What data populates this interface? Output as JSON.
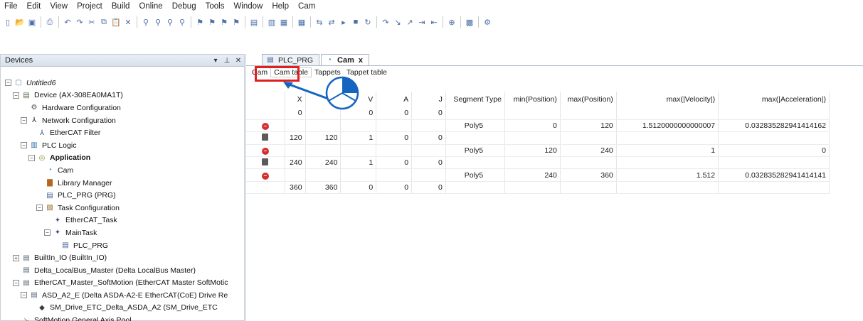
{
  "menu": [
    "File",
    "Edit",
    "View",
    "Project",
    "Build",
    "Online",
    "Debug",
    "Tools",
    "Window",
    "Help",
    "Cam"
  ],
  "toolbar": {
    "icons": [
      "new-icon",
      "open-icon",
      "save-icon",
      "sep",
      "print-icon",
      "sep",
      "undo-icon",
      "redo-icon",
      "cut-icon",
      "copy-icon",
      "paste-icon",
      "delete-icon",
      "sep",
      "find-icon",
      "find-next-icon",
      "find-in-project-icon",
      "replace-icon",
      "sep",
      "bookmark-icon",
      "bookmark-next-icon",
      "bookmark-prev-icon",
      "bookmark-clear-icon",
      "sep",
      "device-icon",
      "sep",
      "compile-icon",
      "generate-icon",
      "sep",
      "grid-icon",
      "sep",
      "login-icon",
      "logout-icon",
      "run-icon",
      "stop-icon",
      "reset-icon",
      "sep",
      "step-over-icon",
      "step-into-icon",
      "step-out-icon",
      "run-to-cursor-icon",
      "set-next-icon",
      "sep",
      "breakpoint-icon",
      "sep",
      "monitor-icon",
      "sep",
      "settings-icon"
    ]
  },
  "devices": {
    "title": "Devices",
    "controls": {
      "pin": "▾",
      "dock": "⊥",
      "close": "✕"
    },
    "tree": [
      {
        "level": 0,
        "exp": "−",
        "icon": "project-icon",
        "label": "Untitled6",
        "style": "italic"
      },
      {
        "level": 1,
        "exp": "−",
        "icon": "device-icon",
        "label": "Device (AX-308EA0MA1T)"
      },
      {
        "level": 2,
        "exp": "",
        "icon": "hardware-config-icon",
        "label": "Hardware Configuration"
      },
      {
        "level": 2,
        "exp": "−",
        "icon": "network-config-icon",
        "label": "Network Configuration"
      },
      {
        "level": 3,
        "exp": "",
        "icon": "ethercat-filter-icon",
        "label": "EtherCAT Filter"
      },
      {
        "level": 2,
        "exp": "−",
        "icon": "plc-logic-icon",
        "label": "PLC Logic"
      },
      {
        "level": 3,
        "exp": "−",
        "icon": "application-icon",
        "label": "Application",
        "style": "bold"
      },
      {
        "level": 4,
        "exp": "",
        "icon": "cam-icon",
        "label": "Cam"
      },
      {
        "level": 4,
        "exp": "",
        "icon": "library-icon",
        "label": "Library Manager"
      },
      {
        "level": 4,
        "exp": "",
        "icon": "pou-icon",
        "label": "PLC_PRG (PRG)"
      },
      {
        "level": 4,
        "exp": "−",
        "icon": "task-config-icon",
        "label": "Task Configuration"
      },
      {
        "level": 5,
        "exp": "",
        "icon": "task-icon",
        "label": "EtherCAT_Task"
      },
      {
        "level": 5,
        "exp": "−",
        "icon": "task-icon",
        "label": "MainTask"
      },
      {
        "level": 6,
        "exp": "",
        "icon": "pou-call-icon",
        "label": "PLC_PRG"
      },
      {
        "level": 1,
        "exp": "+",
        "icon": "io-icon",
        "label": "BuiltIn_IO (BuiltIn_IO)"
      },
      {
        "level": 1,
        "exp": "",
        "icon": "io-icon",
        "label": "Delta_LocalBus_Master (Delta LocalBus Master)"
      },
      {
        "level": 1,
        "exp": "−",
        "icon": "io-icon",
        "label": "EtherCAT_Master_SoftMotion (EtherCAT Master SoftMotic"
      },
      {
        "level": 2,
        "exp": "−",
        "icon": "io-icon",
        "label": "ASD_A2_E (Delta ASDA-A2-E EtherCAT(CoE) Drive Re"
      },
      {
        "level": 3,
        "exp": "",
        "icon": "axis-icon",
        "label": "SM_Drive_ETC_Delta_ASDA_A2 (SM_Drive_ETC"
      },
      {
        "level": 1,
        "exp": "",
        "icon": "axis-pool-icon",
        "label": "SoftMotion General Axis Pool"
      }
    ]
  },
  "editor": {
    "tabs": [
      {
        "label": "PLC_PRG",
        "icon": "pou-icon",
        "active": false
      },
      {
        "label": "Cam",
        "icon": "cam-icon",
        "active": true,
        "close": "x"
      }
    ],
    "subtabs": [
      "Cam",
      "Cam table",
      "Tappets",
      "Tappet table"
    ],
    "selected_subtab": "Cam table",
    "table": {
      "headers": [
        "",
        "X",
        "Y",
        "V",
        "A",
        "J",
        "Segment Type",
        "min(Position)",
        "max(Position)",
        "max(|Velocity|)",
        "max(|Acceleration|)"
      ],
      "rows": [
        {
          "kind": "point",
          "icon": "",
          "cells": [
            "0",
            "",
            "0",
            "0",
            "0",
            "",
            "",
            "",
            "",
            ""
          ]
        },
        {
          "kind": "segment",
          "icon": "delete-segment-icon",
          "cells": [
            "",
            "",
            "",
            "",
            "",
            "Poly5",
            "0",
            "120",
            "1.5120000000000007",
            "0.032835282941414162"
          ]
        },
        {
          "kind": "point",
          "icon": "delete-point-icon",
          "cells": [
            "120",
            "120",
            "1",
            "0",
            "0",
            "",
            "",
            "",
            "",
            ""
          ]
        },
        {
          "kind": "segment",
          "icon": "delete-segment-icon",
          "cells": [
            "",
            "",
            "",
            "",
            "",
            "Poly5",
            "120",
            "240",
            "1",
            "0"
          ]
        },
        {
          "kind": "point",
          "icon": "delete-point-icon",
          "cells": [
            "240",
            "240",
            "1",
            "0",
            "0",
            "",
            "",
            "",
            "",
            ""
          ]
        },
        {
          "kind": "segment",
          "icon": "delete-segment-icon",
          "cells": [
            "",
            "",
            "",
            "",
            "",
            "Poly5",
            "240",
            "360",
            "1.512",
            "0.032835282941414141"
          ]
        },
        {
          "kind": "point",
          "icon": "",
          "cells": [
            "360",
            "360",
            "0",
            "0",
            "0",
            "",
            "",
            "",
            "",
            ""
          ]
        }
      ]
    }
  },
  "colors": {
    "highlight": "#e02020",
    "pointer": "#1565c0",
    "delete": "#d32f2f"
  }
}
